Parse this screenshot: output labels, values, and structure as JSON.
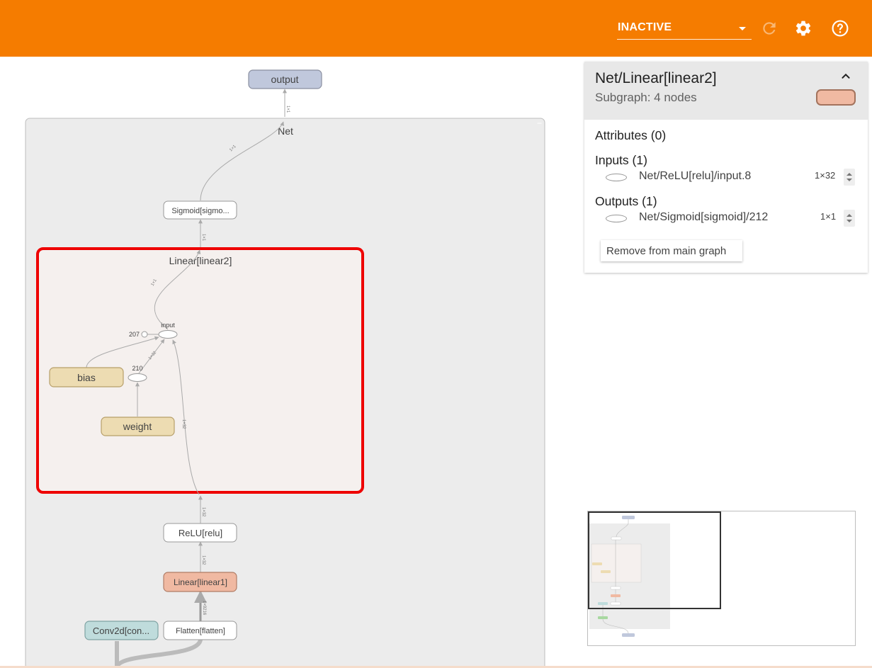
{
  "topbar": {
    "run_selector_value": "INACTIVE",
    "icons": [
      "reload-icon",
      "settings-icon",
      "help-icon"
    ],
    "color": "#f57c00"
  },
  "graph": {
    "output_node": "output",
    "outer_group": "Net",
    "sigmoid_node": "Sigmoid[sigmo...",
    "linear2_group": "Linear[linear2]",
    "input_op": "input",
    "const_207": "207",
    "const_210": "210",
    "bias_node": "bias",
    "weight_node": "weight",
    "relu_node": "ReLU[relu]",
    "linear1_node": "Linear[linear1]",
    "conv_node": "Conv2d[con...",
    "flatten_node": "Flatten[flatten]",
    "edge_labels": {
      "sig_out": "1×1",
      "net_out": "1×1",
      "lin2_out": "1×1",
      "into_sig": "1×1",
      "relu_to_lin2": "1×32",
      "lin1_to_relu": "1×32",
      "flatten_to_lin1": "1×9216",
      "weight_edge": "1×32",
      "inner_edge": "1×32"
    }
  },
  "info_panel": {
    "title": "Net/Linear[linear2]",
    "subtitle": "Subgraph: 4 nodes",
    "swatch_color": "#f0b9a2",
    "attributes_heading": "Attributes (0)",
    "inputs_heading": "Inputs (1)",
    "inputs": [
      {
        "name": "Net/ReLU[relu]/input.8",
        "shape": "1×32"
      }
    ],
    "outputs_heading": "Outputs (1)",
    "outputs": [
      {
        "name": "Net/Sigmoid[sigmoid]/212",
        "shape": "1×1"
      }
    ],
    "remove_button": "Remove from main graph"
  }
}
